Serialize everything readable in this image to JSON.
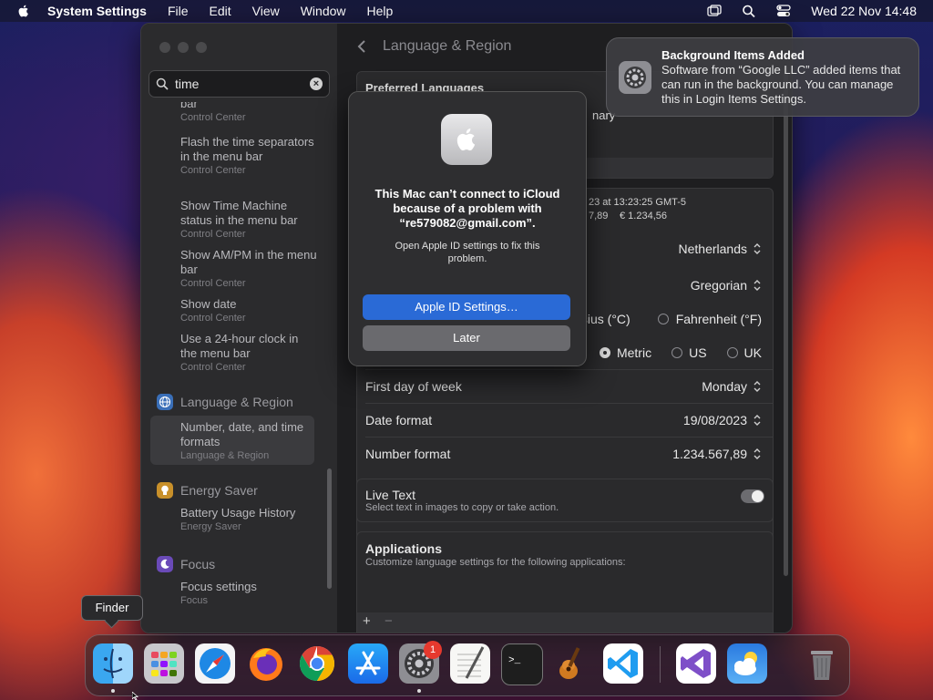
{
  "menubar": {
    "app_name": "System Settings",
    "menus": [
      "File",
      "Edit",
      "View",
      "Window",
      "Help"
    ],
    "datetime": "Wed 22 Nov  14:48"
  },
  "search": {
    "value": "time"
  },
  "sidebar": {
    "items": [
      {
        "title": "bar",
        "subtitle": "Control Center"
      },
      {
        "title": "Flash the time separators in the menu bar",
        "subtitle": "Control Center"
      },
      {
        "title": "Show Time Machine status in the menu bar",
        "subtitle": "Control Center"
      },
      {
        "title": "Show AM/PM in the menu bar",
        "subtitle": "Control Center"
      },
      {
        "title": "Show date",
        "subtitle": "Control Center"
      },
      {
        "title": "Use a 24-hour clock in the menu bar",
        "subtitle": "Control Center"
      }
    ],
    "section_language": "Language & Region",
    "selected_item": {
      "title": "Number, date, and time formats",
      "subtitle": "Language & Region"
    },
    "section_energy": "Energy Saver",
    "energy_item": {
      "title": "Battery Usage History",
      "subtitle": "Energy Saver"
    },
    "section_focus": "Focus",
    "focus_item": {
      "title": "Focus settings",
      "subtitle": "Focus"
    }
  },
  "main": {
    "page_title": "Language & Region",
    "preferred_languages_label": "Preferred Languages",
    "primary_fragment": "nary",
    "preview_date_fragment": "23 at 13:23:25 GMT-5",
    "preview_number_fragment": "7,89",
    "preview_currency": "€ 1.234,56",
    "region_value": "Netherlands",
    "calendar_value": "Gregorian",
    "temp_celsius": "Celsius (°C)",
    "temp_fahrenheit": "Fahrenheit (°F)",
    "measure_metric": "Metric",
    "measure_us": "US",
    "measure_uk": "UK",
    "first_day_label": "First day of week",
    "first_day_value": "Monday",
    "date_format_label": "Date format",
    "date_format_value": "19/08/2023",
    "number_format_label": "Number format",
    "number_format_value": "1.234.567,89",
    "live_text_title": "Live Text",
    "live_text_sub": "Select text in images to copy or take action.",
    "apps_title": "Applications",
    "apps_sub": "Customize language settings for the following applications:",
    "add": "+",
    "remove": "−"
  },
  "dialog": {
    "title": "This Mac can’t connect to iCloud because of a problem with “re579082@gmail.com”.",
    "body": "Open Apple ID settings to fix this problem.",
    "primary_button": "Apple ID Settings…",
    "secondary_button": "Later"
  },
  "notification": {
    "title": "Background Items Added",
    "body": "Software from “Google LLC” added items that can run in the background. You can manage this in Login Items Settings."
  },
  "tooltip": "Finder",
  "dock": {
    "settings_badge": "1",
    "apps": [
      "finder",
      "launchpad",
      "safari",
      "firefox",
      "chrome",
      "app-store",
      "system-settings",
      "textedit",
      "terminal",
      "garageband",
      "vscode",
      "visual-studio",
      "weather",
      "trash"
    ]
  }
}
